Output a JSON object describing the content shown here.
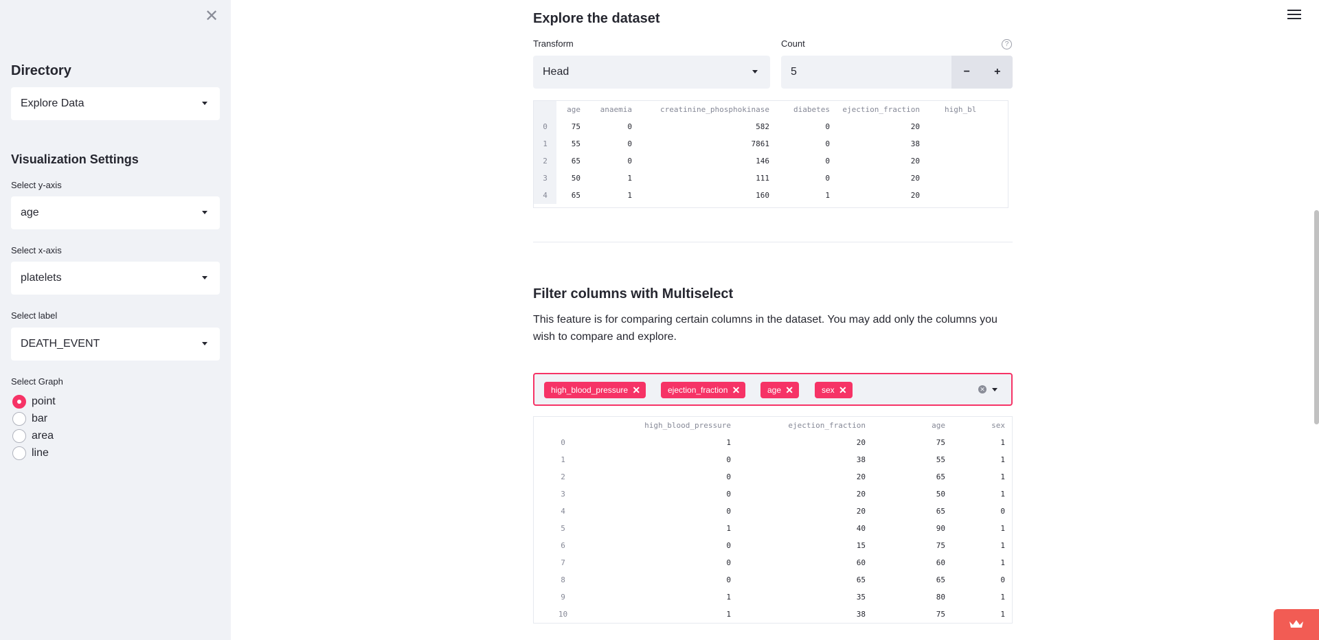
{
  "sidebar": {
    "close_glyph": "✕",
    "directory_heading": "Directory",
    "directory_value": "Explore Data",
    "viz_heading": "Visualization Settings",
    "y_label": "Select y-axis",
    "y_value": "age",
    "x_label": "Select x-axis",
    "x_value": "platelets",
    "label_label": "Select label",
    "label_value": "DEATH_EVENT",
    "graph_label": "Select Graph",
    "graph_options": [
      "point",
      "bar",
      "area",
      "line"
    ],
    "graph_selected": "point"
  },
  "explore": {
    "heading": "Explore the dataset",
    "transform_label": "Transform",
    "transform_value": "Head",
    "count_label": "Count",
    "count_value": "5",
    "help_glyph": "?",
    "minus": "−",
    "plus": "+",
    "columns": [
      "age",
      "anaemia",
      "creatinine_phosphokinase",
      "diabetes",
      "ejection_fraction",
      "high_bl"
    ],
    "rows": [
      [
        "0",
        "75",
        "0",
        "582",
        "0",
        "20",
        ""
      ],
      [
        "1",
        "55",
        "0",
        "7861",
        "0",
        "38",
        ""
      ],
      [
        "2",
        "65",
        "0",
        "146",
        "0",
        "20",
        ""
      ],
      [
        "3",
        "50",
        "1",
        "111",
        "0",
        "20",
        ""
      ],
      [
        "4",
        "65",
        "1",
        "160",
        "1",
        "20",
        ""
      ]
    ]
  },
  "filter": {
    "heading": "Filter columns with Multiselect",
    "description": "This feature is for comparing certain columns in the dataset. You may add only the columns you wish to compare and explore.",
    "chips": [
      "high_blood_pressure",
      "ejection_fraction",
      "age",
      "sex"
    ],
    "chip_remove_glyph": "✕",
    "clear_glyph": "✕",
    "columns": [
      "high_blood_pressure",
      "ejection_fraction",
      "age",
      "sex"
    ],
    "rows": [
      [
        "0",
        "1",
        "20",
        "75",
        "1"
      ],
      [
        "1",
        "0",
        "38",
        "55",
        "1"
      ],
      [
        "2",
        "0",
        "20",
        "65",
        "1"
      ],
      [
        "3",
        "0",
        "20",
        "50",
        "1"
      ],
      [
        "4",
        "0",
        "20",
        "65",
        "0"
      ],
      [
        "5",
        "1",
        "40",
        "90",
        "1"
      ],
      [
        "6",
        "0",
        "15",
        "75",
        "1"
      ],
      [
        "7",
        "0",
        "60",
        "60",
        "1"
      ],
      [
        "8",
        "0",
        "65",
        "65",
        "0"
      ],
      [
        "9",
        "1",
        "35",
        "80",
        "1"
      ],
      [
        "10",
        "1",
        "38",
        "75",
        "1"
      ]
    ]
  },
  "colors": {
    "accent": "#f63366",
    "sidebar_bg": "#f0f2f6",
    "text": "#262730",
    "badge": "#f25c54"
  },
  "icons": {
    "menu": "hamburger-icon",
    "close": "close-icon",
    "help": "help-icon",
    "badge": "crown-icon"
  }
}
